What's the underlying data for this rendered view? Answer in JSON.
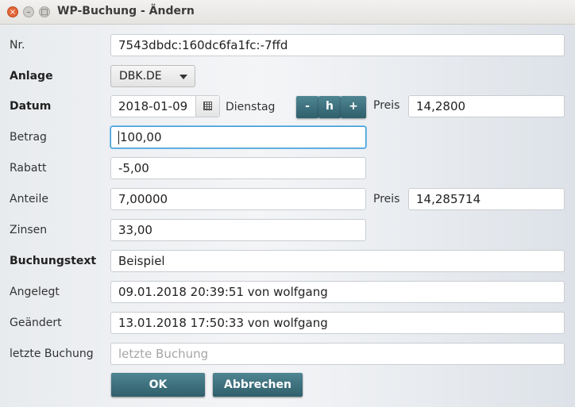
{
  "window": {
    "title": "WP-Buchung - Ändern",
    "close_glyph": "×",
    "minimize_glyph": "–",
    "maximize_glyph": "□"
  },
  "form": {
    "nr": {
      "label": "Nr.",
      "value": "7543dbdc:160dc6fa1fc:-7ffd"
    },
    "anlage": {
      "label": "Anlage",
      "selected": "DBK.DE"
    },
    "datum": {
      "label": "Datum",
      "value": "2018-01-09",
      "weekday": "Dienstag",
      "btn_minus": "-",
      "btn_heute": "h",
      "btn_plus": "+",
      "preis_label": "Preis",
      "preis_value": "14,2800"
    },
    "betrag": {
      "label": "Betrag",
      "value": "100,00"
    },
    "rabatt": {
      "label": "Rabatt",
      "value": "-5,00"
    },
    "anteile": {
      "label": "Anteile",
      "value": "7,00000",
      "preis_label": "Preis",
      "preis_value": "14,285714"
    },
    "zinsen": {
      "label": "Zinsen",
      "value": "33,00"
    },
    "buchungstext": {
      "label": "Buchungstext",
      "value": "Beispiel"
    },
    "angelegt": {
      "label": "Angelegt",
      "value": "09.01.2018 20:39:51 von wolfgang"
    },
    "geaendert": {
      "label": "Geändert",
      "value": "13.01.2018 17:50:33 von wolfgang"
    },
    "letzte_buchung": {
      "label": "letzte Buchung",
      "placeholder": "letzte Buchung",
      "value": ""
    }
  },
  "actions": {
    "ok_label": "OK",
    "cancel_label": "Abbrechen"
  },
  "colors": {
    "accent_button": "#3b6f7c",
    "focus_border": "#3d9ad6",
    "close_button": "#e2663a"
  }
}
